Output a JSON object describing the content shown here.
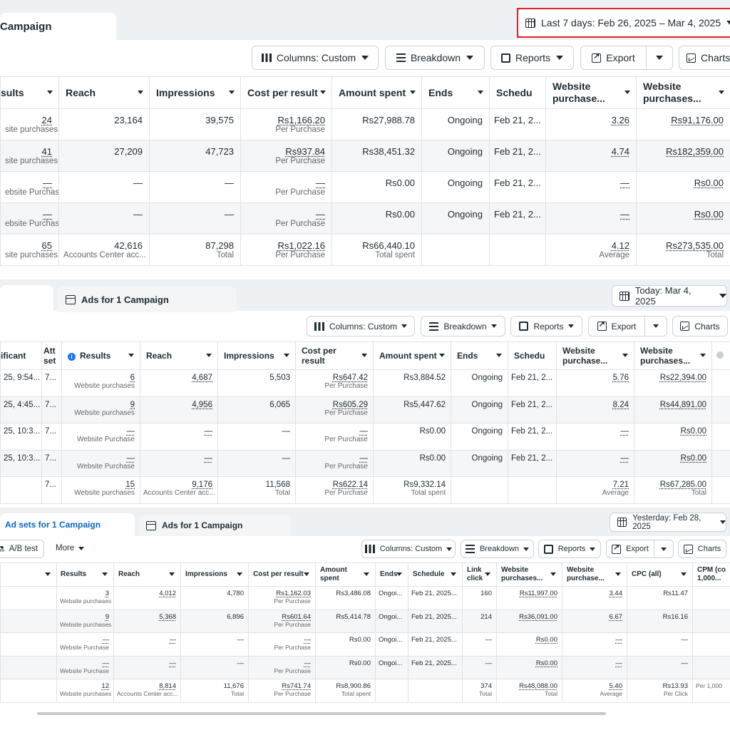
{
  "panel1": {
    "tab_label": "Campaign",
    "date_range": "Last 7 days: Feb 26, 2025 – Mar 4, 2025",
    "toolbar": {
      "columns": "Columns: Custom",
      "breakdown": "Breakdown",
      "reports": "Reports",
      "export": "Export",
      "charts": "Charts"
    },
    "headers": [
      "sults",
      "Reach",
      "Impressions",
      "Cost per result",
      "Amount spent",
      "Ends",
      "Schedu",
      "Website purchase...",
      "Website purchases..."
    ],
    "rows": [
      {
        "results": "24",
        "results_sub": "site purchases",
        "reach": "23,164",
        "impressions": "39,575",
        "cpr": "Rs1,166.20",
        "cpr_sub": "Per Purchase",
        "spent": "Rs27,988.78",
        "spent_sub": "",
        "ends": "Ongoing",
        "schedule": "Feb 21, 2...",
        "roas": "3.26",
        "roas_sub": "",
        "value": "Rs91,176.00",
        "value_sub": ""
      },
      {
        "results": "41",
        "results_sub": "site purchases",
        "reach": "27,209",
        "impressions": "47,723",
        "cpr": "Rs937.84",
        "cpr_sub": "Per Purchase",
        "spent": "Rs38,451.32",
        "spent_sub": "",
        "ends": "Ongoing",
        "schedule": "Feb 21, 2...",
        "roas": "4.74",
        "roas_sub": "",
        "value": "Rs182,359.00",
        "value_sub": ""
      },
      {
        "results": "—",
        "results_sub": "ebsite Purchase",
        "reach": "—",
        "impressions": "—",
        "cpr": "—",
        "cpr_sub": "Per Purchase",
        "spent": "Rs0.00",
        "spent_sub": "",
        "ends": "Ongoing",
        "schedule": "Feb 21, 2...",
        "roas": "—",
        "roas_sub": "",
        "value": "Rs0.00",
        "value_sub": ""
      },
      {
        "results": "—",
        "results_sub": "ebsite Purchase",
        "reach": "—",
        "impressions": "—",
        "cpr": "—",
        "cpr_sub": "Per Purchase",
        "spent": "Rs0.00",
        "spent_sub": "",
        "ends": "Ongoing",
        "schedule": "Feb 21, 2...",
        "roas": "—",
        "roas_sub": "",
        "value": "Rs0.00",
        "value_sub": ""
      },
      {
        "results": "65",
        "results_sub": "site purchases",
        "reach": "42,616",
        "reach_sub": "Accounts Center acc...",
        "impressions": "87,298",
        "impressions_sub": "Total",
        "cpr": "Rs1,022.16",
        "cpr_sub": "Per Purchase",
        "spent": "Rs66,440.10",
        "spent_sub": "Total spent",
        "ends": "",
        "schedule": "",
        "roas": "4.12",
        "roas_sub": "Average",
        "value": "Rs273,535.00",
        "value_sub": "Total"
      }
    ]
  },
  "panel2": {
    "tab_label": "Ads for 1 Campaign",
    "date_range": "Today: Mar 4, 2025",
    "toolbar": {
      "columns": "Columns: Custom",
      "breakdown": "Breakdown",
      "reports": "Reports",
      "export": "Export",
      "charts": "Charts"
    },
    "headers": [
      "ificant",
      "Att set",
      "Results",
      "Reach",
      "Impressions",
      "Cost per result",
      "Amount spent",
      "Ends",
      "Schedu",
      "Website purchase...",
      "Website purchases..."
    ],
    "rows": [
      {
        "sig": "25, 9:54...",
        "att": "7...",
        "results": "6",
        "results_sub": "Website purchases",
        "reach": "4,687",
        "impressions": "5,503",
        "cpr": "Rs647.42",
        "cpr_sub": "Per Purchase",
        "spent": "Rs3,884.52",
        "spent_sub": "",
        "ends": "Ongoing",
        "schedule": "Feb 21, 2...",
        "roas": "5.76",
        "roas_sub": "",
        "value": "Rs22,394.00",
        "value_sub": ""
      },
      {
        "sig": "25, 4:45...",
        "att": "7...",
        "results": "9",
        "results_sub": "Website purchases",
        "reach": "4,956",
        "impressions": "6,065",
        "cpr": "Rs605.29",
        "cpr_sub": "Per Purchase",
        "spent": "Rs5,447.62",
        "spent_sub": "",
        "ends": "Ongoing",
        "schedule": "Feb 21, 2...",
        "roas": "8.24",
        "roas_sub": "",
        "value": "Rs44,891.00",
        "value_sub": ""
      },
      {
        "sig": "25, 10:3...",
        "att": "7...",
        "results": "—",
        "results_sub": "Website Purchase",
        "reach": "—",
        "impressions": "—",
        "cpr": "—",
        "cpr_sub": "Per Purchase",
        "spent": "Rs0.00",
        "spent_sub": "",
        "ends": "Ongoing",
        "schedule": "Feb 21, 2...",
        "roas": "—",
        "roas_sub": "",
        "value": "Rs0.00",
        "value_sub": ""
      },
      {
        "sig": "25, 10:3...",
        "att": "7...",
        "results": "—",
        "results_sub": "Website Purchase",
        "reach": "—",
        "impressions": "—",
        "cpr": "—",
        "cpr_sub": "Per Purchase",
        "spent": "Rs0.00",
        "spent_sub": "",
        "ends": "Ongoing",
        "schedule": "Feb 21, 2...",
        "roas": "—",
        "roas_sub": "",
        "value": "Rs0.00",
        "value_sub": ""
      },
      {
        "sig": "",
        "att": "7...",
        "results": "15",
        "results_sub": "Website purchases",
        "reach": "9,176",
        "reach_sub": "Accounts Center acc...",
        "impressions": "11,568",
        "impressions_sub": "Total",
        "cpr": "Rs622.14",
        "cpr_sub": "Per Purchase",
        "spent": "Rs9,332.14",
        "spent_sub": "Total spent",
        "ends": "",
        "schedule": "",
        "roas": "7.21",
        "roas_sub": "Average",
        "value": "Rs67,285.00",
        "value_sub": "Total"
      }
    ]
  },
  "panel3": {
    "tab_active": "Ad sets for 1 Campaign",
    "tab_inactive": "Ads for 1 Campaign",
    "date_range": "Yesterday: Feb 28, 2025",
    "ab_test": "A/B test",
    "more": "More",
    "toolbar": {
      "columns": "Columns: Custom",
      "breakdown": "Breakdown",
      "reports": "Reports",
      "export": "Export",
      "charts": "Charts"
    },
    "headers": [
      "",
      "Results",
      "Reach",
      "Impressions",
      "Cost per result",
      "Amount spent",
      "Ends",
      "Schedule",
      "Link click",
      "Website purchases...",
      "Website purchase...",
      "CPC (all)",
      "CPM (co 1,000..."
    ],
    "rows": [
      {
        "results": "3",
        "results_sub": "Website purchases",
        "reach": "4,012",
        "impressions": "4,780",
        "cpr": "Rs1,162.03",
        "cpr_sub": "Per Purchase",
        "spent": "Rs3,486.08",
        "spent_sub": "",
        "ends": "Ongoi...",
        "schedule": "Feb 21, 2025...",
        "link": "160",
        "link_sub": "",
        "value": "Rs11,997.00",
        "value_sub": "",
        "roas": "3.44",
        "roas_sub": "",
        "cpc": "Rs11.47",
        "cpc_sub": "",
        "cpm": "",
        "cpm_sub": ""
      },
      {
        "results": "9",
        "results_sub": "Website purchases",
        "reach": "5,368",
        "impressions": "6,896",
        "cpr": "Rs601.64",
        "cpr_sub": "Per Purchase",
        "spent": "Rs5,414.78",
        "spent_sub": "",
        "ends": "Ongoi...",
        "schedule": "Feb 21, 2025...",
        "link": "214",
        "link_sub": "",
        "value": "Rs36,091.00",
        "value_sub": "",
        "roas": "6.67",
        "roas_sub": "",
        "cpc": "Rs16.16",
        "cpc_sub": "",
        "cpm": "",
        "cpm_sub": ""
      },
      {
        "results": "—",
        "results_sub": "Website Purchase",
        "reach": "—",
        "impressions": "—",
        "cpr": "—",
        "cpr_sub": "Per Purchase",
        "spent": "Rs0.00",
        "spent_sub": "",
        "ends": "Ongoi...",
        "schedule": "Feb 21, 2025...",
        "link": "—",
        "link_sub": "",
        "value": "Rs0.00",
        "value_sub": "",
        "roas": "—",
        "roas_sub": "",
        "cpc": "—",
        "cpc_sub": "",
        "cpm": "",
        "cpm_sub": ""
      },
      {
        "results": "—",
        "results_sub": "Website Purchase",
        "reach": "—",
        "impressions": "—",
        "cpr": "—",
        "cpr_sub": "Per Purchase",
        "spent": "Rs0.00",
        "spent_sub": "",
        "ends": "Ongoi...",
        "schedule": "Feb 21, 2025...",
        "link": "—",
        "link_sub": "",
        "value": "Rs0.00",
        "value_sub": "",
        "roas": "—",
        "roas_sub": "",
        "cpc": "—",
        "cpc_sub": "",
        "cpm": "",
        "cpm_sub": ""
      },
      {
        "results": "12",
        "results_sub": "Website purchases",
        "reach": "8,814",
        "reach_sub": "Accounts Center acc...",
        "impressions": "11,676",
        "impressions_sub": "Total",
        "cpr": "Rs741.74",
        "cpr_sub": "Per Purchase",
        "spent": "Rs8,900.86",
        "spent_sub": "Total spent",
        "ends": "",
        "schedule": "",
        "link": "374",
        "link_sub": "Total",
        "value": "Rs48,088.00",
        "value_sub": "Total",
        "roas": "5.40",
        "roas_sub": "Average",
        "cpc": "Rs13.93",
        "cpc_sub": "Per Click",
        "cpm": "",
        "cpm_sub": "Per 1,000"
      }
    ]
  },
  "colors": {
    "highlight": "#e0242b",
    "active_tab_text": "#0a66c2",
    "info": "#1877f2"
  }
}
